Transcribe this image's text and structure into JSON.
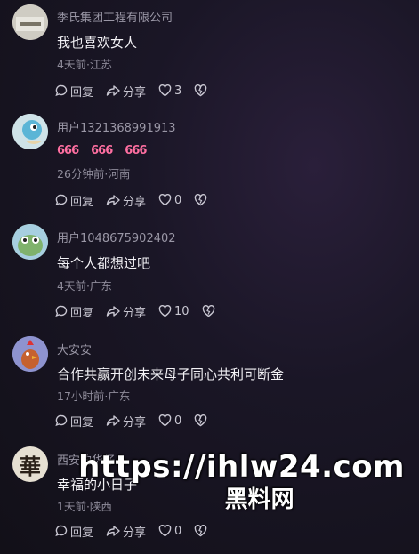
{
  "comments": [
    {
      "username": "季氏集团工程有限公司",
      "text": "我也喜欢女人",
      "meta": "4天前·江苏",
      "reply_label": "回复",
      "share_label": "分享",
      "likes": "3"
    },
    {
      "username": "用户1321368991913",
      "text": "",
      "meta": "26分钟前·河南",
      "reply_label": "回复",
      "share_label": "分享",
      "likes": "0",
      "emojis": [
        "666",
        "666",
        "666"
      ]
    },
    {
      "username": "用户1048675902402",
      "text": "每个人都想过吧",
      "meta": "4天前·广东",
      "reply_label": "回复",
      "share_label": "分享",
      "likes": "10"
    },
    {
      "username": "大安安",
      "text": "合作共赢开创未来母子同心共利可断金",
      "meta": "17小时前·广东",
      "reply_label": "回复",
      "share_label": "分享",
      "likes": "0"
    },
    {
      "username": "西安的华仔",
      "text": "幸福的小日子",
      "meta": "1天前·陕西",
      "reply_label": "回复",
      "share_label": "分享",
      "likes": "0",
      "avatar_char": "華"
    }
  ],
  "watermark": {
    "url": "https://ihlw24.com",
    "name": "黑料网"
  },
  "colors": {
    "bg": "#1a1626",
    "meta": "#8f8c9b",
    "emoji": "#ff6fa1"
  }
}
